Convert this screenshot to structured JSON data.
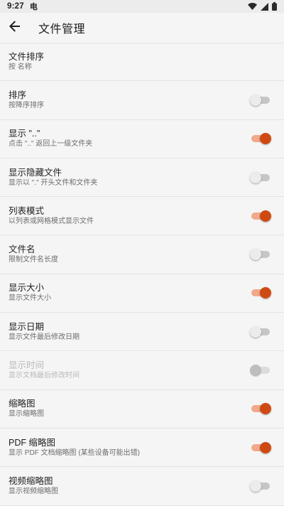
{
  "status_bar": {
    "time": "9:27",
    "notification_glyph": "电"
  },
  "toolbar": {
    "title": "文件管理",
    "back_icon": "arrow-back-icon"
  },
  "colors": {
    "accent": "#cf4a12",
    "accent_track": "#f0a98a",
    "background": "#f5f5f5",
    "divider": "#e3e3e3"
  },
  "settings": [
    {
      "title": "文件排序",
      "summary": "按 名称",
      "has_switch": false
    },
    {
      "title": "排序",
      "summary": "按降序排序",
      "has_switch": true,
      "checked": false,
      "enabled": true
    },
    {
      "title": "显示 \"..\"",
      "summary": "点击 \"..\" 返回上一级文件夹",
      "has_switch": true,
      "checked": true,
      "enabled": true
    },
    {
      "title": "显示隐藏文件",
      "summary": "显示以 \".\" 开头文件和文件夹",
      "has_switch": true,
      "checked": false,
      "enabled": true
    },
    {
      "title": "列表模式",
      "summary": "以列表或网格模式显示文件",
      "has_switch": true,
      "checked": true,
      "enabled": true
    },
    {
      "title": "文件名",
      "summary": "限制文件名长度",
      "has_switch": true,
      "checked": false,
      "enabled": true
    },
    {
      "title": "显示大小",
      "summary": "显示文件大小",
      "has_switch": true,
      "checked": true,
      "enabled": true
    },
    {
      "title": "显示日期",
      "summary": "显示文件最后修改日期",
      "has_switch": true,
      "checked": false,
      "enabled": true
    },
    {
      "title": "显示时间",
      "summary": "显示文档最后修改时间",
      "has_switch": true,
      "checked": false,
      "enabled": false
    },
    {
      "title": "缩略图",
      "summary": "显示缩略图",
      "has_switch": true,
      "checked": true,
      "enabled": true
    },
    {
      "title": "PDF 缩略图",
      "summary": "显示 PDF 文档缩略图 (某些设备可能出错)",
      "has_switch": true,
      "checked": true,
      "enabled": true
    },
    {
      "title": "视频缩略图",
      "summary": "显示视频缩略图",
      "has_switch": true,
      "checked": false,
      "enabled": true
    }
  ]
}
